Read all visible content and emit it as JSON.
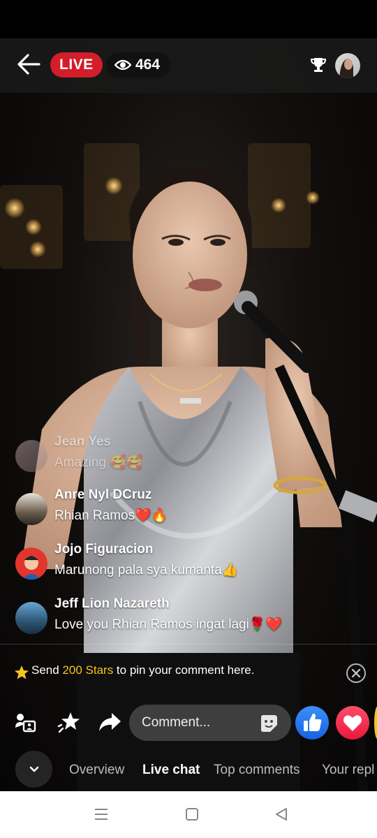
{
  "header": {
    "live_label": "LIVE",
    "viewer_count": "464",
    "icons": [
      "back-arrow-icon",
      "eye-icon",
      "trophy-icon",
      "host-avatar"
    ]
  },
  "comments": [
    {
      "name": "Jean Yes",
      "text": "Amazing 🥰🥰",
      "faded": true
    },
    {
      "name": "Anre Nyl DCruz",
      "text": "Rhian Ramos❤️🔥"
    },
    {
      "name": "Jojo Figuracion",
      "text": "Marunong pala sya kumanta👍"
    },
    {
      "name": "Jeff Lion Nazareth",
      "text": "Love you Rhian Ramos ingat lagi🌹❤️"
    }
  ],
  "pin": {
    "prefix": "Send ",
    "stars": "200 Stars",
    "suffix": " to pin your comment here."
  },
  "actions": {
    "comment_placeholder": "Comment...",
    "icons": [
      "person-card-icon",
      "stars-icon",
      "share-icon",
      "sticker-icon",
      "like-icon",
      "love-icon"
    ]
  },
  "tabs": [
    {
      "label": "Overview",
      "active": false
    },
    {
      "label": "Live chat",
      "active": true
    },
    {
      "label": "Top comments",
      "active": false
    },
    {
      "label": "Your repl",
      "active": false
    }
  ],
  "colors": {
    "live_red": "#d31d2a",
    "stars_gold": "#f5c518",
    "like_blue": "#1877f2",
    "love_red": "#f02849"
  }
}
